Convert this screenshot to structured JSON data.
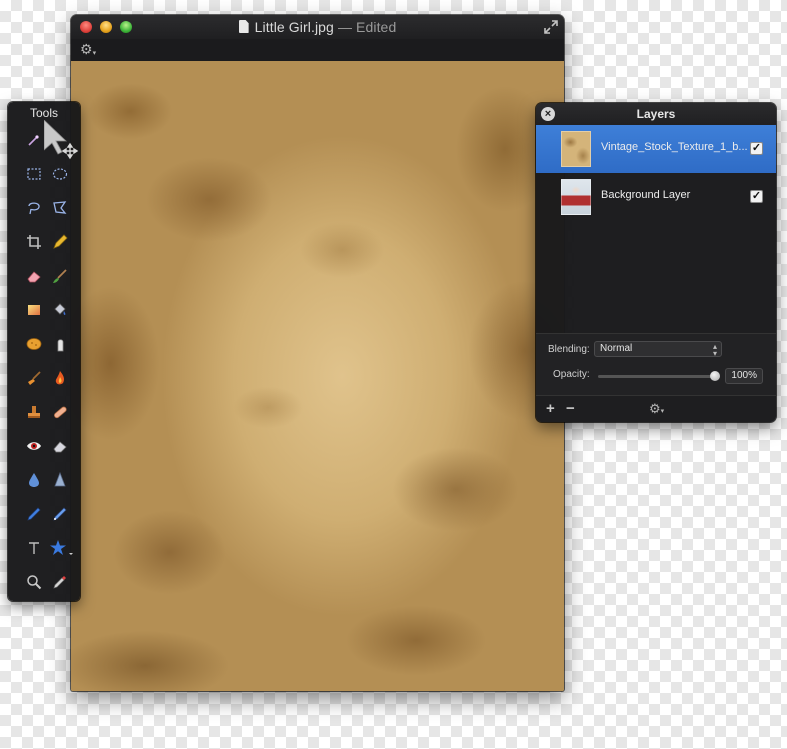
{
  "window": {
    "filename": "Little Girl.jpg",
    "status": " — Edited",
    "fullscreen_icon": "fullscreen-arrows-icon",
    "gear_icon": "gear-icon"
  },
  "tools": {
    "title": "Tools",
    "items": [
      {
        "name": "magic-wand-tool",
        "icon": "magic-wand-icon"
      },
      {
        "name": "move-tool",
        "icon": "move-arrow-icon"
      },
      {
        "name": "rect-select-tool",
        "icon": "rectangle-select-icon"
      },
      {
        "name": "ellipse-select-tool",
        "icon": "ellipse-select-icon"
      },
      {
        "name": "lasso-tool",
        "icon": "lasso-icon"
      },
      {
        "name": "polygon-lasso-tool",
        "icon": "polygon-lasso-icon"
      },
      {
        "name": "crop-tool",
        "icon": "crop-icon"
      },
      {
        "name": "pencil-tool",
        "icon": "pencil-icon"
      },
      {
        "name": "eraser-tool",
        "icon": "eraser-icon"
      },
      {
        "name": "brush-tool",
        "icon": "brush-icon"
      },
      {
        "name": "gradient-tool",
        "icon": "gradient-icon"
      },
      {
        "name": "paint-bucket-tool",
        "icon": "paint-bucket-icon"
      },
      {
        "name": "sponge-tool",
        "icon": "sponge-icon"
      },
      {
        "name": "smudge-tool",
        "icon": "finger-smudge-icon"
      },
      {
        "name": "broom-tool",
        "icon": "broom-icon"
      },
      {
        "name": "burn-tool",
        "icon": "flame-icon"
      },
      {
        "name": "stamp-tool",
        "icon": "clone-stamp-icon"
      },
      {
        "name": "heal-tool",
        "icon": "bandage-icon"
      },
      {
        "name": "red-eye-tool",
        "icon": "eye-icon"
      },
      {
        "name": "eraser-block-tool",
        "icon": "eraser-block-icon"
      },
      {
        "name": "blur-tool",
        "icon": "water-drop-icon"
      },
      {
        "name": "sharpen-tool",
        "icon": "sharpen-cone-icon"
      },
      {
        "name": "pen-tool",
        "icon": "pen-icon"
      },
      {
        "name": "vector-pen-tool",
        "icon": "vector-pen-icon"
      },
      {
        "name": "text-tool",
        "icon": "text-icon"
      },
      {
        "name": "shape-tool",
        "icon": "star-shape-icon"
      },
      {
        "name": "zoom-tool",
        "icon": "magnifier-icon"
      },
      {
        "name": "eyedropper-tool",
        "icon": "eyedropper-icon"
      }
    ]
  },
  "layers": {
    "title": "Layers",
    "close_icon": "close-icon",
    "items": [
      {
        "name": "Vintage_Stock_Texture_1_b...",
        "visible": true,
        "selected": true
      },
      {
        "name": "Background Layer",
        "visible": true,
        "selected": false
      }
    ],
    "blending_label": "Blending:",
    "blending_value": "Normal",
    "opacity_label": "Opacity:",
    "opacity_value": "100%",
    "opacity": 1.0,
    "add_label": "+",
    "remove_label": "−",
    "check_mark": "✓",
    "select_arrows": "▲▼"
  },
  "colors": {
    "selection": "#3a78d4",
    "panel_bg": "#1b1b1d",
    "texture": "#c8a468"
  }
}
